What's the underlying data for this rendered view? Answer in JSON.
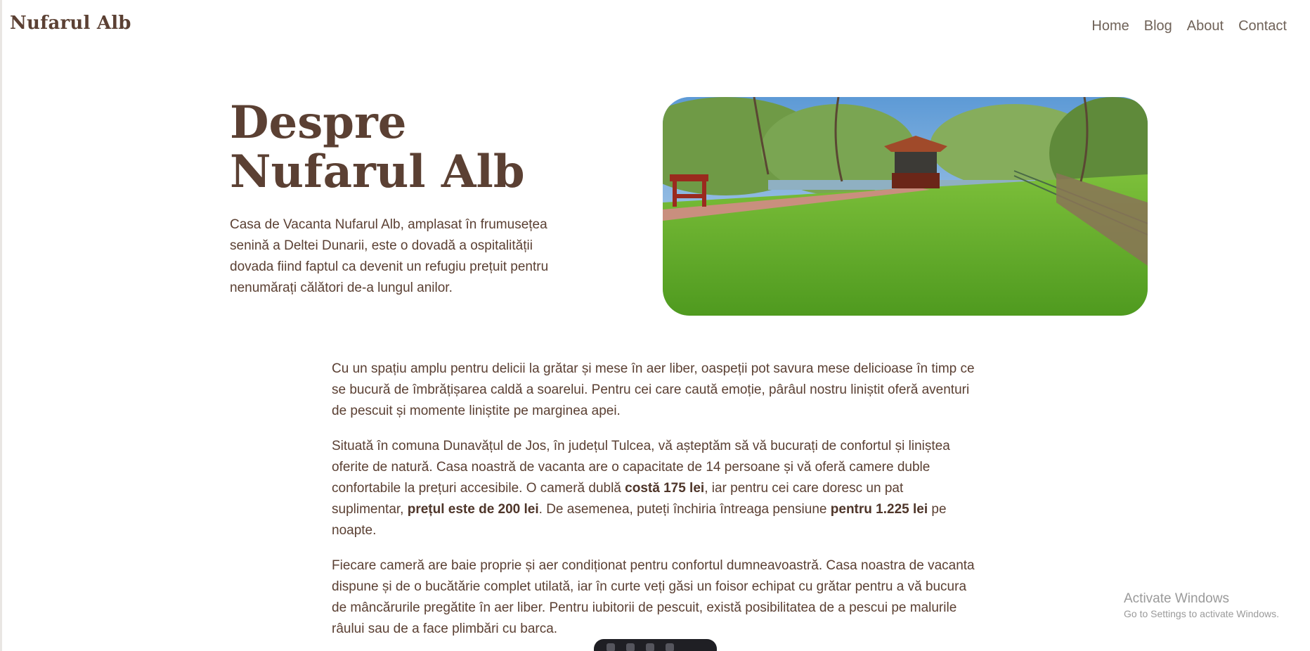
{
  "brand": "Nufarul Alb",
  "nav": [
    "Home",
    "Blog",
    "About",
    "Contact"
  ],
  "hero": {
    "title_line1": "Despre",
    "title_line2": "Nufarul Alb",
    "intro": "Casa de Vacanta Nufarul Alb, amplasat în frumusețea senină a Deltei Dunarii, este o dovadă a ospitalității dovada fiind faptul ca devenit un refugiu prețuit pentru nenumărați călători de-a lungul anilor."
  },
  "paragraphs": {
    "p1": "Cu un spațiu amplu pentru delicii la grătar și mese în aer liber, oaspeții pot savura mese delicioase în timp ce se bucură de îmbrățișarea caldă a soarelui. Pentru cei care caută emoție, pârâul nostru liniștit oferă aventuri de pescuit și momente liniștite pe marginea apei.",
    "p2": {
      "part1": "Situată în comuna Dunavățul de Jos, în județul Tulcea, vă așteptăm să vă bucurați de confortul și liniștea oferite de natură. Casa noastră de vacanta are o capacitate de 14 persoane și vă oferă camere duble confortabile la prețuri accesibile. O cameră dublă ",
      "bold1": "costă 175 lei",
      "part2": ", iar pentru cei care doresc un pat suplimentar, ",
      "bold2": "prețul este de 200 lei",
      "part3": ". De asemenea, puteți închiria întreaga pensiune ",
      "bold3": "pentru 1.225 lei",
      "part4": " pe noapte."
    },
    "p3": "Fiecare cameră are baie proprie și aer condiționat pentru confortul dumneavoastră. Casa noastra de vacanta dispune și de o bucătărie complet utilată, iar în curte veți găsi un foisor echipat cu grătar pentru a vă bucura de mâncărurile pregătite în aer liber. Pentru iubitorii de pescuit, există posibilitatea de a pescui pe malurile râului sau de a face plimbări cu barca."
  },
  "watermark": {
    "line1": "Activate Windows",
    "line2": "Go to Settings to activate Windows."
  }
}
